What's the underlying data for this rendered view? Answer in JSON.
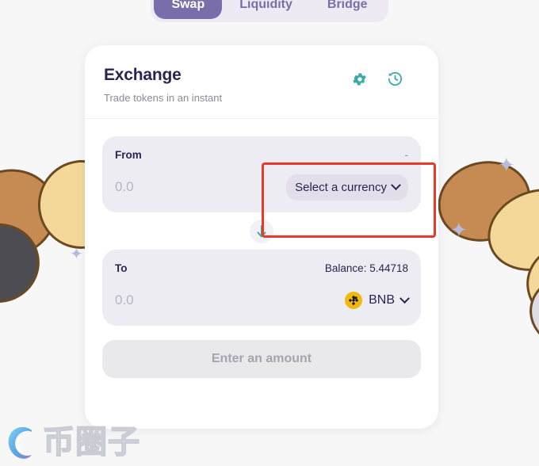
{
  "nav": {
    "tabs": [
      {
        "label": "Swap",
        "active": true
      },
      {
        "label": "Liquidity",
        "active": false
      },
      {
        "label": "Bridge",
        "active": false
      }
    ]
  },
  "card": {
    "title": "Exchange",
    "subtitle": "Trade tokens in an instant",
    "settings_icon": "gear-icon",
    "history_icon": "history-clock-icon"
  },
  "from_panel": {
    "label": "From",
    "right_indicator": "-",
    "amount_value": "0.0",
    "amount_placeholder": "0.0",
    "currency_button_label": "Select a currency",
    "chevron_icon": "chevron-down-icon"
  },
  "swap": {
    "arrow_icon": "arrow-down-icon"
  },
  "to_panel": {
    "label": "To",
    "balance_label": "Balance: 5.44718",
    "amount_value": "0.0",
    "amount_placeholder": "0.0",
    "token_symbol": "BNB",
    "token_icon": "bnb-token-icon",
    "chevron_icon": "chevron-down-icon"
  },
  "cta": {
    "label": "Enter an amount",
    "disabled": true
  },
  "watermark": {
    "text": "币圈子",
    "logo_icon": "spiral-logo-icon"
  },
  "colors": {
    "accent_purple": "#7a6eaa",
    "title_navy": "#2b2352",
    "teal_icon": "#3aa9a8",
    "bnb_gold": "#f0b90b",
    "annotation_red": "#e8392a",
    "panel_bg": "#eeecf3",
    "page_bg": "#f7f7f8"
  }
}
